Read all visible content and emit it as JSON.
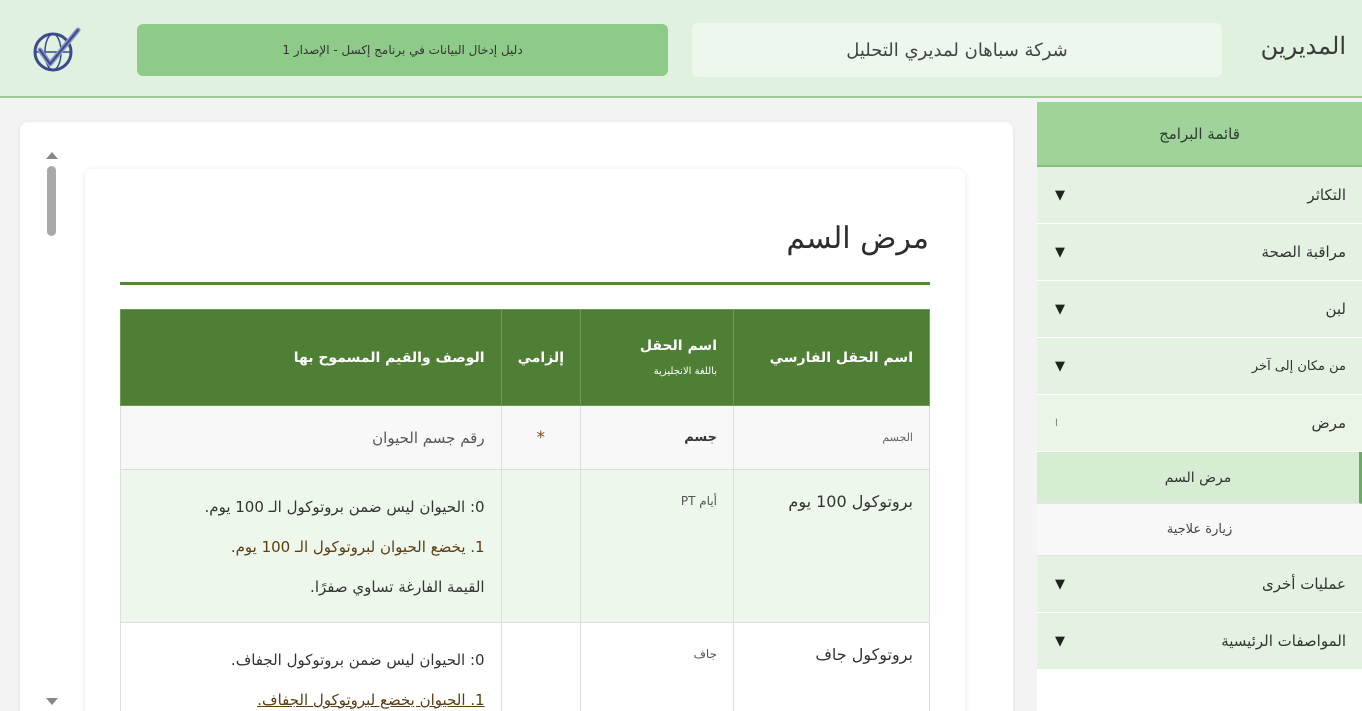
{
  "header": {
    "brand": "المديرين",
    "company": "شركة سباهان لمديري التحليل",
    "guide": "دليل إدخال البيانات في برنامج إكسل - الإصدار 1",
    "logo_icon": "checkmark-globe-icon"
  },
  "sidebar": {
    "title": "قائمة البرامج",
    "items": [
      {
        "label": "التكاثر",
        "arrow": "▼"
      },
      {
        "label": "مراقبة الصحة",
        "arrow": "▼"
      },
      {
        "label": "لبن",
        "arrow": "▼"
      },
      {
        "label": "من مكان إلى آخر",
        "arrow": "▼"
      },
      {
        "label": "مرض",
        "arrow": "ا"
      }
    ],
    "subitems": [
      {
        "label": "مرض السم"
      },
      {
        "label": "زيارة علاجية"
      }
    ],
    "bottom_items": [
      {
        "label": "عمليات أخرى",
        "arrow": "▼"
      },
      {
        "label": "المواصفات الرئيسية",
        "arrow": "▼"
      }
    ]
  },
  "page": {
    "title": "مرض السم"
  },
  "table": {
    "headers": {
      "fa_field": "اسم الحقل الفارسي",
      "en_field": "اسم الحقل",
      "en_field_sub": "باللغة الانجليزية",
      "required": "إلزامي",
      "desc": "الوصف والقيم المسموح بها"
    },
    "rows": [
      {
        "fa": "الجسم",
        "en": "جسم",
        "required": "*",
        "desc": [
          "رقم جسم الحيوان"
        ]
      },
      {
        "fa": "بروتوكول 100 يوم",
        "en": "أيام PT",
        "required": "",
        "desc": [
          "0: الحيوان ليس ضمن بروتوكول الـ 100 يوم.",
          "1. يخضع الحيوان لبروتوكول الـ 100 يوم.",
          "القيمة الفارغة تساوي صفرًا."
        ]
      },
      {
        "fa": "بروتوكول جاف",
        "en": "جاف",
        "required": "",
        "desc": [
          "0: الحيوان ليس ضمن بروتوكول الجفاف.",
          "1. الحيوان يخضع لبروتوكول الجفاف."
        ]
      }
    ]
  },
  "colors": {
    "header_bg": "#e1f1e0",
    "table_header": "#4f7f35",
    "accent": "#4e8a3a"
  }
}
